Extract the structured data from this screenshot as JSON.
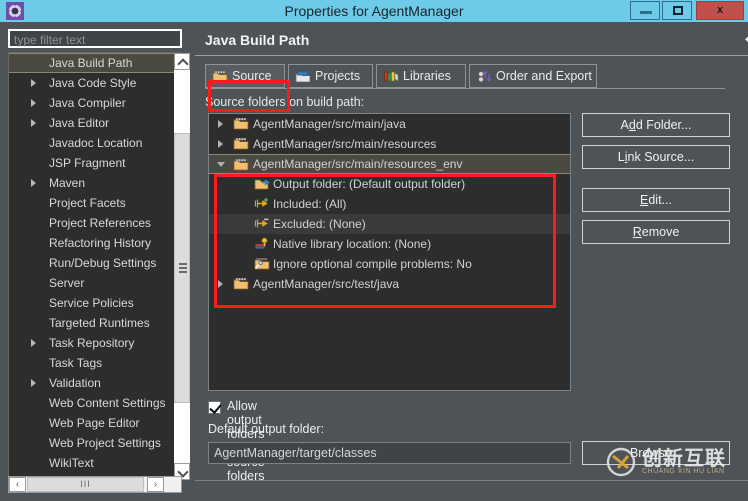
{
  "window": {
    "title": "Properties for AgentManager",
    "app_icon": "gear-icon",
    "minimize_label": "",
    "maximize_label": "",
    "close_label": "x"
  },
  "sidebar": {
    "filter_placeholder": "type filter text",
    "filter_value": "",
    "items": [
      {
        "label": "Java Build Path",
        "expandable": false,
        "selected": true
      },
      {
        "label": "Java Code Style",
        "expandable": true,
        "selected": false
      },
      {
        "label": "Java Compiler",
        "expandable": true,
        "selected": false
      },
      {
        "label": "Java Editor",
        "expandable": true,
        "selected": false
      },
      {
        "label": "Javadoc Location",
        "expandable": false,
        "selected": false
      },
      {
        "label": "JSP Fragment",
        "expandable": false,
        "selected": false
      },
      {
        "label": "Maven",
        "expandable": true,
        "selected": false
      },
      {
        "label": "Project Facets",
        "expandable": false,
        "selected": false
      },
      {
        "label": "Project References",
        "expandable": false,
        "selected": false
      },
      {
        "label": "Refactoring History",
        "expandable": false,
        "selected": false
      },
      {
        "label": "Run/Debug Settings",
        "expandable": false,
        "selected": false
      },
      {
        "label": "Server",
        "expandable": false,
        "selected": false
      },
      {
        "label": "Service Policies",
        "expandable": false,
        "selected": false
      },
      {
        "label": "Targeted Runtimes",
        "expandable": false,
        "selected": false
      },
      {
        "label": "Task Repository",
        "expandable": true,
        "selected": false
      },
      {
        "label": "Task Tags",
        "expandable": false,
        "selected": false
      },
      {
        "label": "Validation",
        "expandable": true,
        "selected": false
      },
      {
        "label": "Web Content Settings",
        "expandable": false,
        "selected": false
      },
      {
        "label": "Web Page Editor",
        "expandable": false,
        "selected": false
      },
      {
        "label": "Web Project Settings",
        "expandable": false,
        "selected": false
      },
      {
        "label": "WikiText",
        "expandable": false,
        "selected": false
      }
    ],
    "hscroll": {
      "left_glyph": "‹",
      "right_glyph": "›",
      "thumb_glyph": "III"
    }
  },
  "content": {
    "page_title": "Java Build Path",
    "nav": {
      "back_glyph": "⬅",
      "forward_glyph": "➡",
      "menu_icon": "chevron-down-icon"
    },
    "tabs": [
      {
        "label": "Source",
        "icon": "source-folder-icon",
        "active": true
      },
      {
        "label": "Projects",
        "icon": "projects-icon",
        "active": false
      },
      {
        "label": "Libraries",
        "icon": "libraries-icon",
        "active": false
      },
      {
        "label": "Order and Export",
        "icon": "order-export-icon",
        "active": false
      }
    ],
    "source_label": "Source folders on build path:",
    "tree": [
      {
        "label": "AgentManager/src/main/java",
        "level": 1,
        "state": "collapsed",
        "icon": "source-folder-icon",
        "selected": false
      },
      {
        "label": "AgentManager/src/main/resources",
        "level": 1,
        "state": "collapsed",
        "icon": "source-folder-icon",
        "selected": false
      },
      {
        "label": "AgentManager/src/main/resources_env",
        "level": 1,
        "state": "expanded",
        "icon": "source-folder-icon",
        "selected": true
      },
      {
        "label": "Output folder: (Default output folder)",
        "level": 2,
        "state": "leaf",
        "icon": "output-folder-icon",
        "selected": false
      },
      {
        "label": "Included: (All)",
        "level": 2,
        "state": "leaf",
        "icon": "included-icon",
        "selected": false
      },
      {
        "label": "Excluded: (None)",
        "level": 2,
        "state": "leaf",
        "icon": "excluded-icon",
        "selected": false
      },
      {
        "label": "Native library location: (None)",
        "level": 2,
        "state": "leaf",
        "icon": "native-library-icon",
        "selected": false
      },
      {
        "label": "Ignore optional compile problems: No",
        "level": 2,
        "state": "leaf",
        "icon": "ignore-problems-icon",
        "selected": false
      },
      {
        "label": "AgentManager/src/test/java",
        "level": 1,
        "state": "collapsed",
        "icon": "test-source-folder-icon",
        "selected": false
      }
    ],
    "buttons": [
      {
        "label": "Add Folder...",
        "mnemonic": "d"
      },
      {
        "label": "Link Source...",
        "mnemonic": "i"
      },
      {
        "label": "Edit...",
        "mnemonic": "E"
      },
      {
        "label": "Remove",
        "mnemonic": "R"
      }
    ],
    "allow_output_checkbox": {
      "label": "Allow output folders for source folders",
      "checked": true
    },
    "default_output_label": "Default output folder:",
    "default_output_value": "AgentManager/target/classes",
    "browse_button": "Browse..."
  },
  "watermark": {
    "text": "创新互联",
    "subtext": "CHUANG XIN HU LIAN"
  },
  "colors": {
    "titlebar": "#6ecbe8",
    "close_button": "#c0504d",
    "dialog_bg": "#4d5356",
    "tree_bg": "#2d2d2d",
    "annotation_red": "#ff1a1a",
    "selection": "#4a4a42"
  }
}
